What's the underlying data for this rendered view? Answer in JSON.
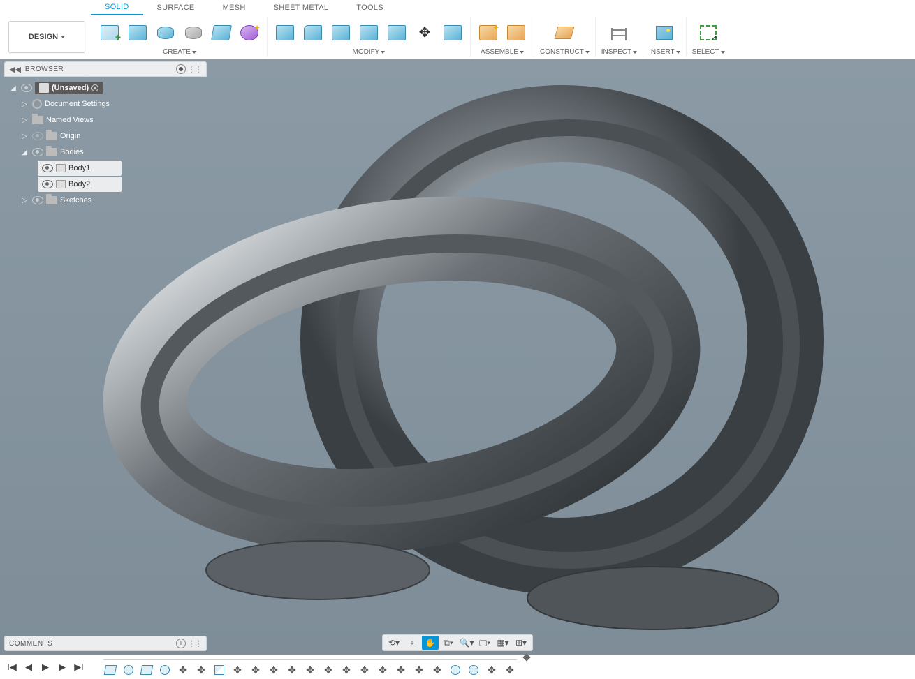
{
  "workspace": {
    "label": "DESIGN"
  },
  "ribbonTabs": [
    {
      "label": "SOLID",
      "active": true
    },
    {
      "label": "SURFACE"
    },
    {
      "label": "MESH"
    },
    {
      "label": "SHEET METAL"
    },
    {
      "label": "TOOLS"
    }
  ],
  "groups": {
    "create": "CREATE",
    "modify": "MODIFY",
    "assemble": "ASSEMBLE",
    "construct": "CONSTRUCT",
    "inspect": "INSPECT",
    "insert": "INSERT",
    "select": "SELECT"
  },
  "browser": {
    "title": "BROWSER",
    "root": "(Unsaved)",
    "items": {
      "docSettings": "Document Settings",
      "namedViews": "Named Views",
      "origin": "Origin",
      "bodies": "Bodies",
      "body1": "Body1",
      "body2": "Body2",
      "sketches": "Sketches"
    }
  },
  "comments": {
    "title": "COMMENTS"
  },
  "navTools": [
    "orbit",
    "camera",
    "pan",
    "zoom-window",
    "zoom-fit",
    "display",
    "grid",
    "layout"
  ],
  "timelineOps": [
    "sketch",
    "revolve",
    "sketch",
    "revolve",
    "move",
    "move",
    "chamfer",
    "move",
    "move",
    "move",
    "move",
    "move",
    "move",
    "move",
    "move",
    "move",
    "move",
    "move",
    "move",
    "revolve",
    "revolve",
    "move",
    "move"
  ]
}
